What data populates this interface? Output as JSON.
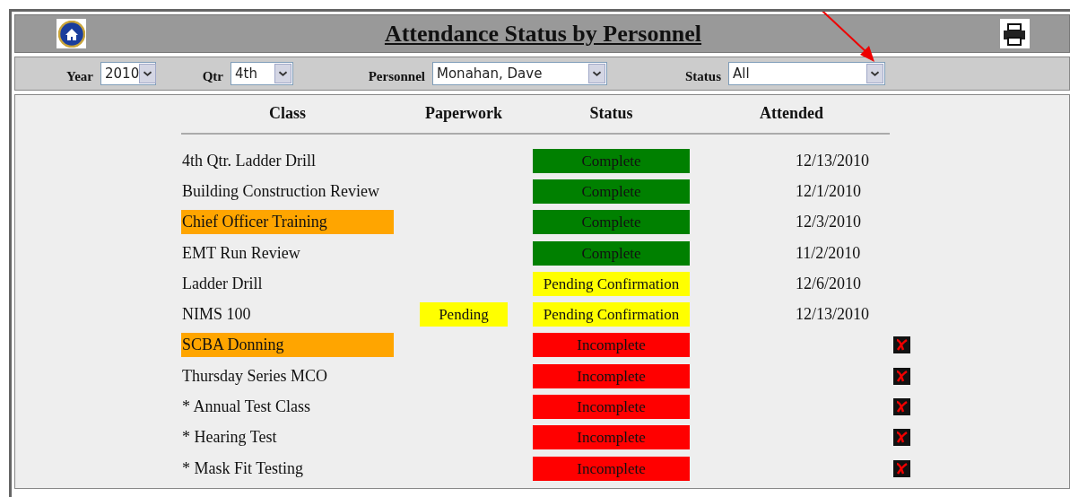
{
  "title": "Attendance Status by Personnel",
  "filters": [
    {
      "label": "Year",
      "value": "2010"
    },
    {
      "label": "Qtr",
      "value": "4th"
    },
    {
      "label": "Personnel",
      "value": "Monahan, Dave"
    },
    {
      "label": "Status",
      "value": "All"
    }
  ],
  "columns": [
    "Class",
    "Paperwork",
    "Status",
    "Attended"
  ],
  "rows": [
    {
      "class": "4th Qtr. Ladder Drill",
      "highlighted": false,
      "status": "Complete",
      "color": "#008000",
      "attended": "12/13/2010"
    },
    {
      "class": "Building Construction Review",
      "highlighted": false,
      "status": "Complete",
      "color": "#008000",
      "attended": "12/1/2010"
    },
    {
      "class": "Chief Officer Training",
      "highlighted": true,
      "status": "Complete",
      "color": "#008000",
      "attended": "12/3/2010"
    },
    {
      "class": "EMT Run Review",
      "highlighted": false,
      "status": "Complete",
      "color": "#008000",
      "attended": "11/2/2010"
    },
    {
      "class": "Ladder Drill",
      "highlighted": false,
      "status": "Pending Confirmation",
      "color": "#ffff00",
      "attended": "12/6/2010"
    },
    {
      "class": "NIMS 100",
      "highlighted": false,
      "paperwork": "Pending",
      "status": "Pending Confirmation",
      "color": "#ffff00",
      "attended": "12/13/2010"
    },
    {
      "class": "SCBA Donning",
      "highlighted": true,
      "status": "Incomplete",
      "color": "#ff0000"
    },
    {
      "class": "Thursday Series MCO",
      "highlighted": false,
      "status": "Incomplete",
      "color": "#ff0000"
    },
    {
      "class": "* Annual Test Class",
      "highlighted": false,
      "status": "Incomplete",
      "color": "#ff0000"
    },
    {
      "class": "* Hearing Test",
      "highlighted": false,
      "status": "Incomplete",
      "color": "#ff0000"
    },
    {
      "class": "* Mask Fit Testing",
      "highlighted": false,
      "status": "Incomplete",
      "color": "#ff0000"
    }
  ]
}
